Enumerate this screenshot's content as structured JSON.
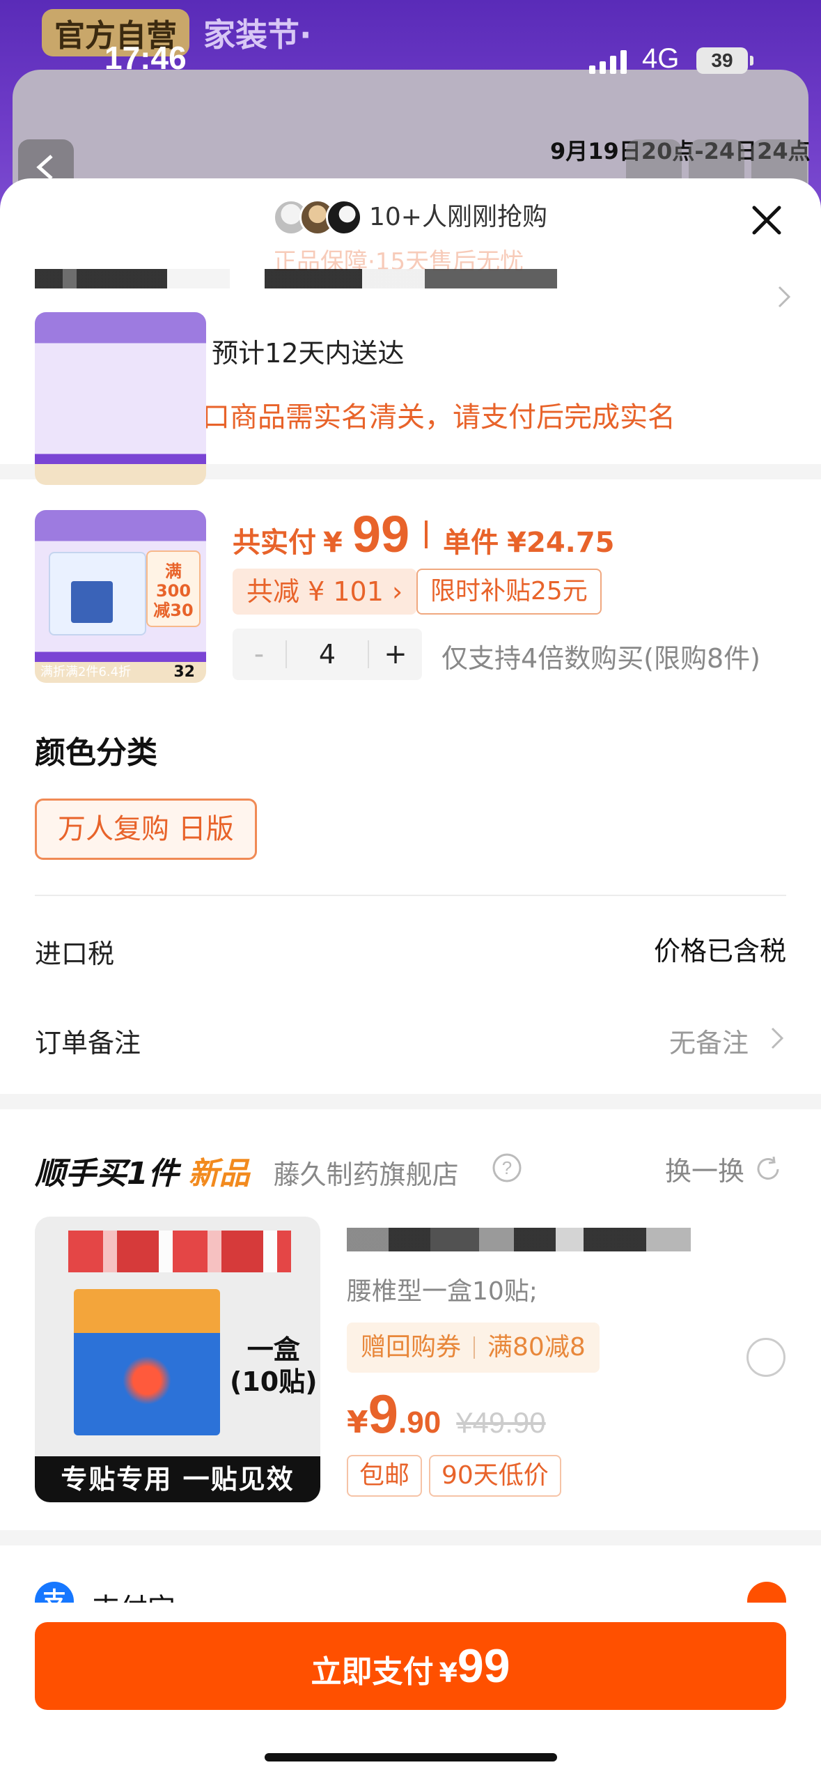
{
  "status_bar": {
    "time": "17:46",
    "network": "4G",
    "battery": "39"
  },
  "background": {
    "badge": "官方自营",
    "festival": "家装节·",
    "date_banner": "9月19日20点-24日24点"
  },
  "sheet": {
    "buyers_text": "10+人刚刚抢购",
    "guarantee": "正品保障·15天售后无忧",
    "shipping": "运费 包邮 预计12天内送达",
    "notice": "含跨境进口商品需实名清关，请支付后完成实名"
  },
  "product": {
    "thumb": {
      "tag": "满300减30",
      "footer": "满折满2件6.4折",
      "footer_price": "32"
    },
    "total_label": "共实付",
    "currency": "¥",
    "total_amount": "99",
    "unit_label": "单件",
    "unit_price": "¥24.75",
    "saving": "共减 ¥ 101 ›",
    "subsidy": "限时补贴25元",
    "quantity": "4",
    "minus": "-",
    "plus": "+",
    "limit": "仅支持4倍数购买(限购8件)",
    "variant_title": "颜色分类",
    "variant_selected": "万人复购 日版"
  },
  "rows": {
    "import_tax_label": "进口税",
    "import_tax_value": "价格已含税",
    "remark_label": "订单备注",
    "remark_value": "无备注"
  },
  "addon": {
    "title": "顺手买1件",
    "new_label": "新品",
    "store": "藤久制药旗舰店",
    "swap": "换一换",
    "box_text_1": "一盒",
    "box_text_2": "(10贴)",
    "banner": "专贴专用 一贴见效",
    "spec": "腰椎型一盒10贴;",
    "coupon_a": "赠回购券",
    "coupon_b": "满80减8",
    "price_yen": "¥",
    "price_int": "9",
    "price_dec": ".90",
    "price_orig": "¥49.90",
    "tag_1": "包邮",
    "tag_2": "90天低价"
  },
  "payment": {
    "method": "支付宝",
    "method_icon": "支",
    "button_label": "立即支付",
    "button_currency": "¥",
    "button_amount": "99"
  },
  "colors": {
    "accent": "#ff5000",
    "price": "#e8632a",
    "purple": "#6f3cc8"
  }
}
